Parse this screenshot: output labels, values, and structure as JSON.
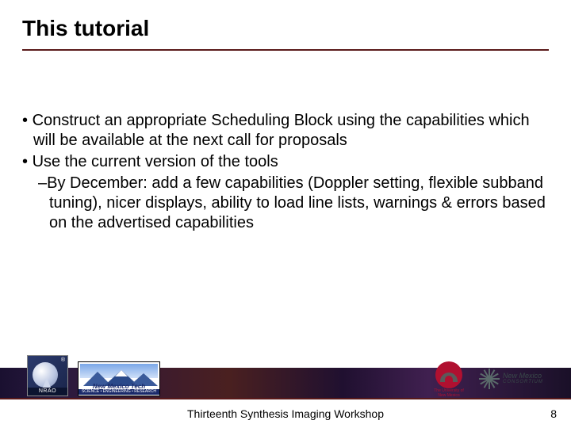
{
  "title": "This tutorial",
  "bullets": {
    "b1": "Construct an appropriate Scheduling Block using the capabilities which will be available at the next call for proposals",
    "b2": "Use the current version of the tools",
    "b2_1": "By December: add a few capabilities (Doppler setting, flexible subband tuning), nicer displays, ability to load line lists, warnings & errors based on the advertised capabilities"
  },
  "footer": {
    "workshop": "Thirteenth Synthesis Imaging Workshop",
    "page": "8"
  },
  "logos": {
    "nrao": {
      "label": "NRAO",
      "reg": "®"
    },
    "nmt": {
      "name": "New Mexico Tech",
      "sub": "SCIENCE • ENGINEERING • RESEARCH"
    },
    "unm": {
      "line1": "The University of",
      "line2": "New Mexico"
    },
    "nmc": {
      "line1": "New Mexico",
      "line2": "CONSORTIUM"
    }
  }
}
